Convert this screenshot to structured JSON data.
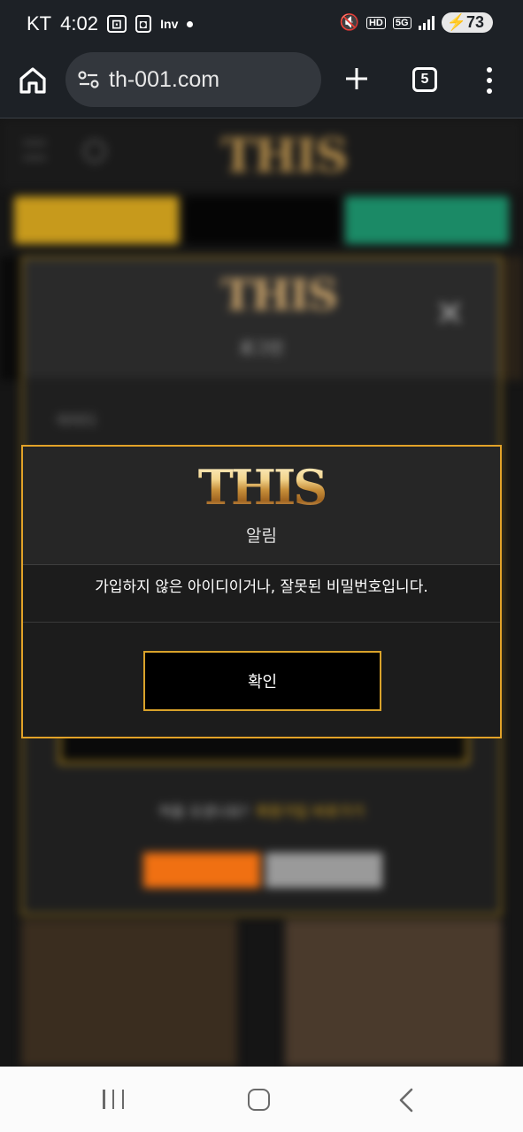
{
  "status_bar": {
    "carrier": "KT",
    "time": "4:02",
    "battery": "73",
    "network": "5G",
    "hd": "HD"
  },
  "browser": {
    "url": "th-001.com",
    "tab_count": "5"
  },
  "background": {
    "logo": "THIS",
    "login_title": "로그인",
    "id_label": "아이디",
    "first_visit": "처음 오셨나요?",
    "signup_link": "회원가입 바로가기"
  },
  "alert": {
    "logo": "THIS",
    "title": "알림",
    "message": "가입하지 않은 아이디이거나, 잘못된 비밀번호입니다.",
    "confirm_label": "확인"
  },
  "colors": {
    "accent_gold": "#e2a228",
    "background": "#1c1c1c"
  }
}
